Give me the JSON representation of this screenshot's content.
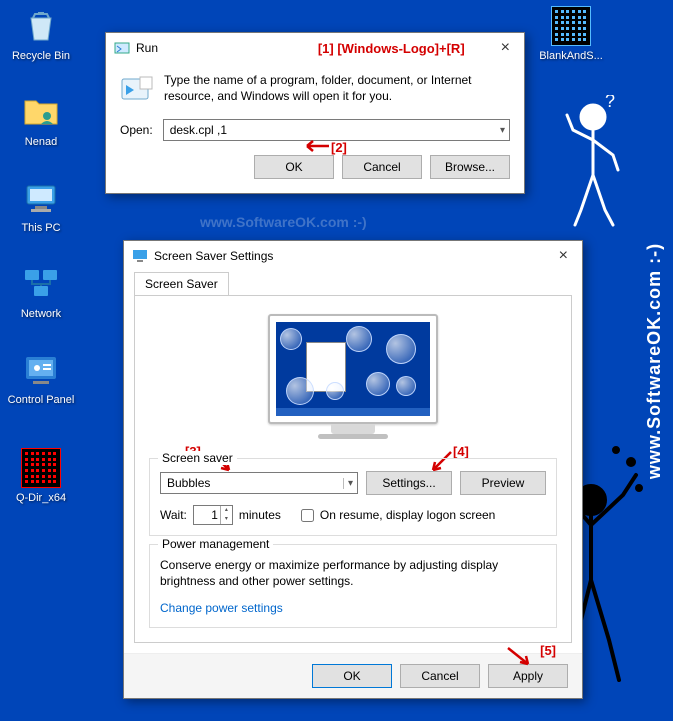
{
  "watermark_right": "www.SoftwareOK.com :-)",
  "watermark_faint": "www.SoftwareOK.com :-)",
  "desktop": {
    "recycle_bin": "Recycle Bin",
    "nenad": "Nenad",
    "this_pc": "This PC",
    "network": "Network",
    "control_panel": "Control Panel",
    "qdir": "Q-Dir_x64",
    "blankands": "BlankAndS..."
  },
  "run": {
    "title": "Run",
    "hint": "Type the name of a program, folder, document, or Internet resource, and Windows will open it for you.",
    "open_label": "Open:",
    "open_value": "desk.cpl ,1",
    "ok": "OK",
    "cancel": "Cancel",
    "browse": "Browse..."
  },
  "annotations": {
    "a1": "[1] [Windows-Logo]+[R]",
    "a2": "[2]",
    "a3": "[3]",
    "a4": "[4]",
    "a5": "[5]"
  },
  "ss": {
    "title": "Screen Saver Settings",
    "tab": "Screen Saver",
    "group_label": "Screen saver",
    "saver_value": "Bubbles",
    "settings_btn": "Settings...",
    "preview_btn": "Preview",
    "wait_label": "Wait:",
    "wait_value": "1",
    "wait_minutes": "minutes",
    "on_resume": "On resume, display logon screen",
    "pm_group": "Power management",
    "pm_text": "Conserve energy or maximize performance by adjusting display brightness and other power settings.",
    "pm_link": "Change power settings",
    "ok": "OK",
    "cancel": "Cancel",
    "apply": "Apply"
  }
}
